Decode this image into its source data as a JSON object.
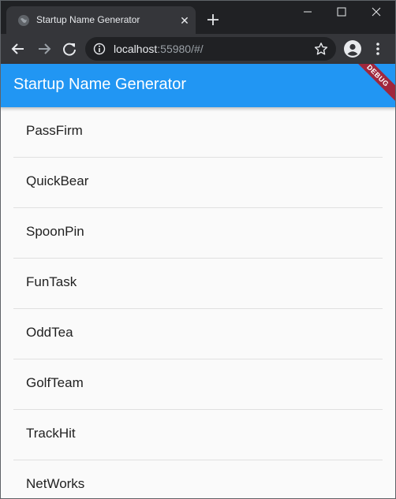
{
  "browser": {
    "tab_title": "Startup Name Generator",
    "url_host": "localhost",
    "url_rest": ":55980/#/"
  },
  "app": {
    "title": "Startup Name Generator",
    "debug_label": "DEBUG",
    "accent_color": "#2196f3",
    "items": [
      {
        "label": "PassFirm"
      },
      {
        "label": "QuickBear"
      },
      {
        "label": "SpoonPin"
      },
      {
        "label": "FunTask"
      },
      {
        "label": "OddTea"
      },
      {
        "label": "GolfTeam"
      },
      {
        "label": "TrackHit"
      },
      {
        "label": "NetWorks"
      }
    ]
  }
}
